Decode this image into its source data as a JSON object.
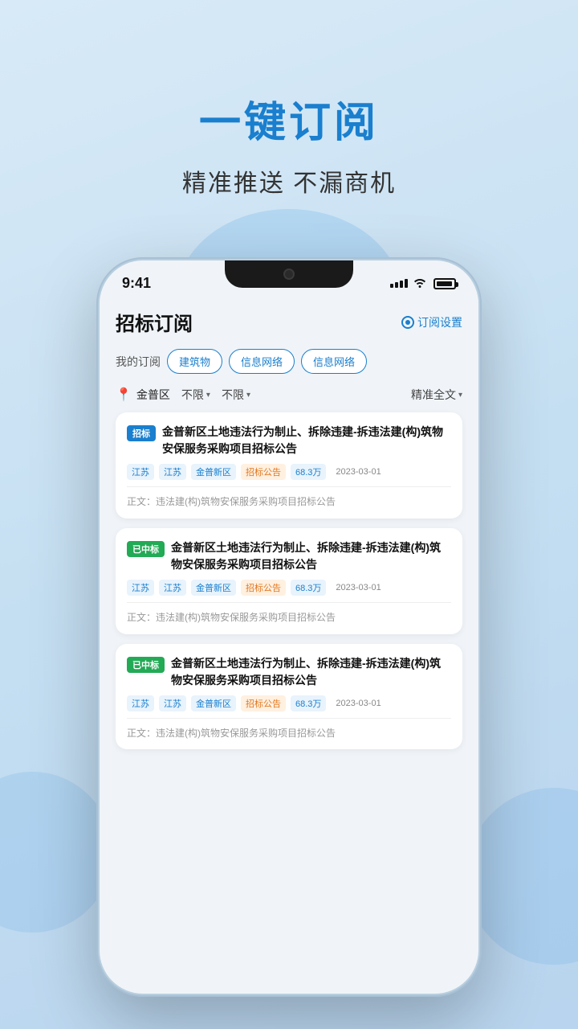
{
  "hero": {
    "title": "一键订阅",
    "subtitle": "精准推送 不漏商机"
  },
  "status_bar": {
    "time": "9:41"
  },
  "app": {
    "title": "招标订阅",
    "settings_label": "订阅设置",
    "my_subscription_label": "我的订阅",
    "filter_tabs": [
      {
        "label": "建筑物"
      },
      {
        "label": "信息网络"
      },
      {
        "label": "信息网络"
      }
    ],
    "location": "金普区",
    "filters": [
      {
        "label": "不限"
      },
      {
        "label": "不限"
      },
      {
        "label": "精准全文"
      }
    ],
    "cards": [
      {
        "badge": "招标",
        "badge_type": "zhaobiao",
        "title": "金普新区土地违法行为制止、拆除违建-拆违法建(构)筑物安保服务采购项目招标公告",
        "tags": [
          "江苏",
          "江苏",
          "金普新区",
          "招标公告",
          "68.3万",
          "2023-03-01"
        ],
        "preview": "正文：违法建(构)筑物安保服务采购项目招标公告"
      },
      {
        "badge": "已中标",
        "badge_type": "zhongbiao",
        "title": "金普新区土地违法行为制止、拆除违建-拆违法建(构)筑物安保服务采购项目招标公告",
        "tags": [
          "江苏",
          "江苏",
          "金普新区",
          "招标公告",
          "68.3万",
          "2023-03-01"
        ],
        "preview": "正文：违法建(构)筑物安保服务采购项目招标公告"
      },
      {
        "badge": "已中标",
        "badge_type": "zhongbiao",
        "title": "金普新区土地违法行为制止、拆除违建-拆违法建(构)筑物安保服务采购项目招标公告",
        "tags": [
          "江苏",
          "江苏",
          "金普新区",
          "招标公告",
          "68.3万",
          "2023-03-01"
        ],
        "preview": "正文：违法建(构)筑物安保服务采购项目招标公告"
      }
    ]
  }
}
